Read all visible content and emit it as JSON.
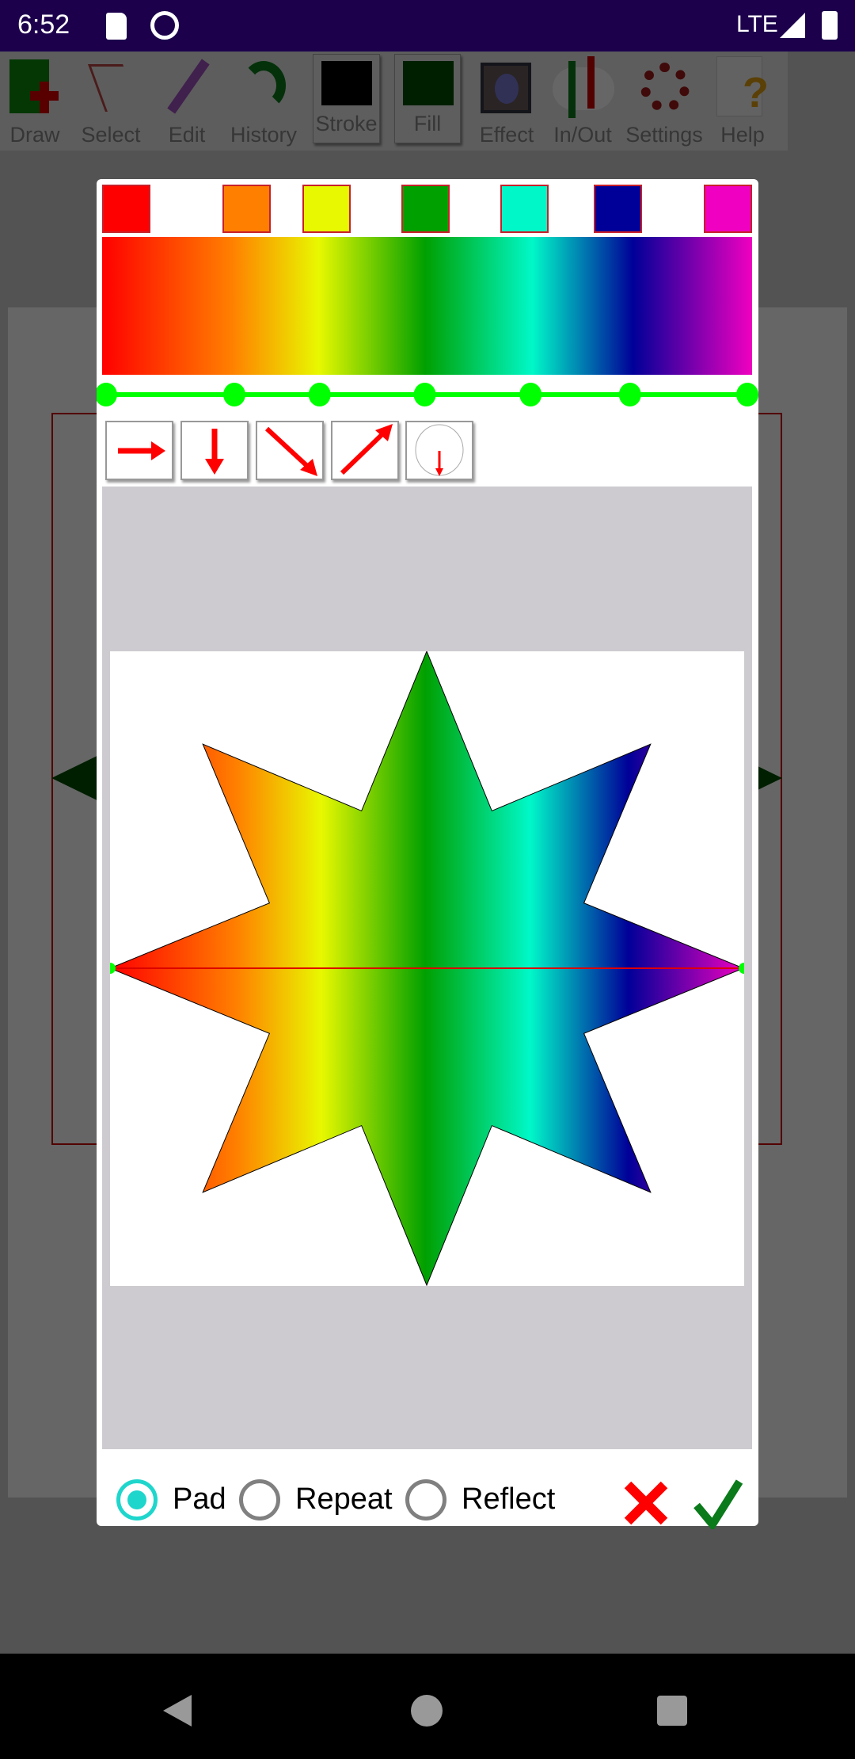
{
  "status_bar": {
    "time": "6:52",
    "network": "LTE",
    "icons": [
      "sd-card-icon",
      "app-notification-icon",
      "signal-icon",
      "battery-icon"
    ]
  },
  "toolbar": {
    "items": [
      {
        "label": "Draw",
        "icon": "draw-icon"
      },
      {
        "label": "Select",
        "icon": "select-hand-icon"
      },
      {
        "label": "Edit",
        "icon": "pencil-icon"
      },
      {
        "label": "History",
        "icon": "undo-redo-icon"
      },
      {
        "label": "Stroke",
        "icon": "stroke-swatch",
        "color": "#000000"
      },
      {
        "label": "Fill",
        "icon": "fill-swatch",
        "color": "#004d00"
      },
      {
        "label": "Effect",
        "icon": "effect-icon"
      },
      {
        "label": "In/Out",
        "icon": "import-export-icon"
      },
      {
        "label": "Settings",
        "icon": "gear-icon"
      },
      {
        "label": "Help",
        "icon": "help-icon"
      }
    ]
  },
  "gradient_dialog": {
    "stops": [
      {
        "offset": 0,
        "color": "#ff0000"
      },
      {
        "offset": 0.2,
        "color": "#ff8000"
      },
      {
        "offset": 0.333,
        "color": "#e8f800"
      },
      {
        "offset": 0.497,
        "color": "#00a000"
      },
      {
        "offset": 0.662,
        "color": "#00f8c8"
      },
      {
        "offset": 0.817,
        "color": "#000098"
      },
      {
        "offset": 1,
        "color": "#f000c0"
      }
    ],
    "directions": [
      "horizontal-arrow-icon",
      "vertical-arrow-icon",
      "diagonal-down-arrow-icon",
      "diagonal-up-arrow-icon",
      "radial-icon"
    ],
    "spread_modes": [
      {
        "label": "Pad",
        "selected": true
      },
      {
        "label": "Repeat",
        "selected": false
      },
      {
        "label": "Reflect",
        "selected": false
      }
    ],
    "cancel_icon": "close-icon",
    "ok_icon": "checkmark-icon",
    "accent": "#1fd6cc"
  }
}
